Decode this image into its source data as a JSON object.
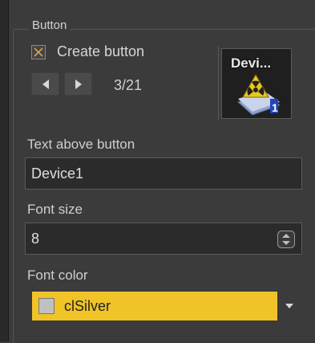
{
  "group": {
    "title": "Button"
  },
  "create_button": {
    "label": "Create button",
    "checked": true
  },
  "nav": {
    "counter": "3/21",
    "prev_icon": "triangle-left",
    "next_icon": "triangle-right"
  },
  "preview": {
    "text": "Devi..."
  },
  "text_above": {
    "label": "Text above button",
    "value": "Device1"
  },
  "font_size": {
    "label": "Font size",
    "value": "8"
  },
  "font_color": {
    "label": "Font color",
    "value": "clSilver",
    "swatch_color": "#c0c0c0",
    "highlight_color": "#f0c428"
  }
}
